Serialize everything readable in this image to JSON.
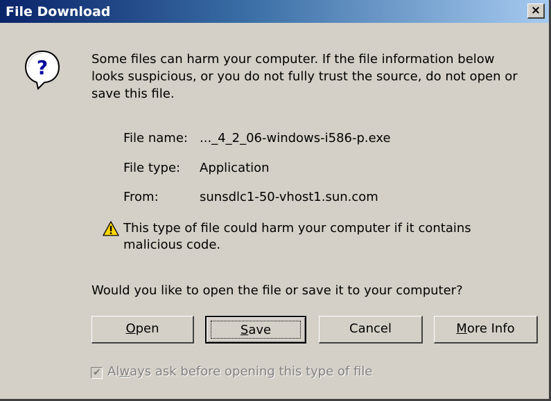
{
  "window": {
    "title": "File Download",
    "close_glyph": "×"
  },
  "message": {
    "line1": "Some files can harm your computer. If the file information below",
    "line2": "looks suspicious, or you do not fully trust the source, do not open or",
    "line3": "save this file."
  },
  "file_info": {
    "name_label": "File name:",
    "name_value": "..._4_2_06-windows-i586-p.exe",
    "type_label": "File type:",
    "type_value": "Application",
    "from_label": "From:",
    "from_value": "sunsdlc1-50-vhost1.sun.com"
  },
  "warning": {
    "icon": "warning-icon",
    "line1": "This type of file could harm your computer if it contains",
    "line2": "malicious code."
  },
  "prompt": "Would you like to open the file or save it to your computer?",
  "buttons": {
    "open_pre": "",
    "open_mnemonic": "O",
    "open_post": "pen",
    "save_pre": "",
    "save_mnemonic": "S",
    "save_post": "ave",
    "cancel": "Cancel",
    "moreinfo_pre": "",
    "moreinfo_mnemonic": "M",
    "moreinfo_post": "ore Info"
  },
  "checkbox": {
    "checked": true,
    "label_pre": "Al",
    "label_mnemonic": "w",
    "label_post": "ays ask before opening this type of file"
  },
  "icons": {
    "question": "question-icon",
    "close": "close-icon",
    "check": "check-icon"
  }
}
